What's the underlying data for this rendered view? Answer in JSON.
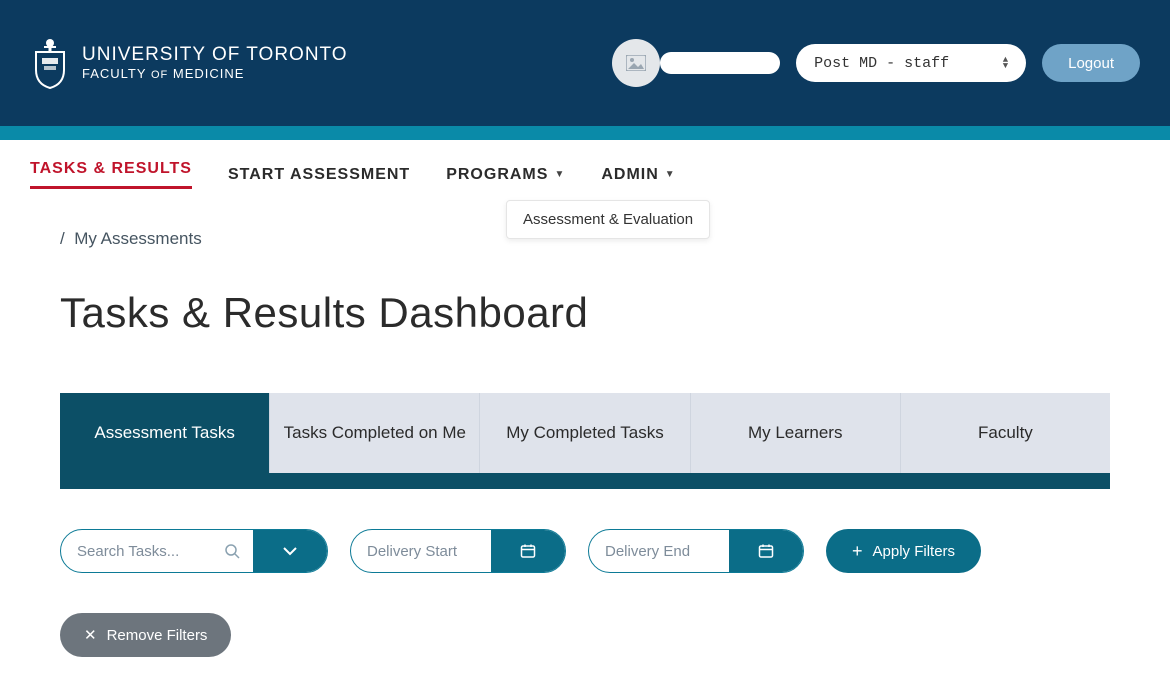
{
  "header": {
    "logo_line1": "UNIVERSITY OF TORONTO",
    "logo_line2_a": "FACULTY",
    "logo_line2_of": "OF",
    "logo_line2_b": "MEDICINE",
    "role_value": "Post MD - staff",
    "logout_label": "Logout"
  },
  "nav": {
    "items": [
      {
        "label": "TASKS & RESULTS",
        "active": true
      },
      {
        "label": "START ASSESSMENT",
        "active": false
      },
      {
        "label": "PROGRAMS",
        "active": false,
        "caret": true
      },
      {
        "label": "ADMIN",
        "active": false,
        "caret": true
      }
    ],
    "dropdown_item": "Assessment & Evaluation"
  },
  "breadcrumb": {
    "sep": "/",
    "current": "My Assessments"
  },
  "page_title": "Tasks & Results Dashboard",
  "tabs": [
    {
      "label": "Assessment Tasks",
      "active": true
    },
    {
      "label": "Tasks Completed on Me",
      "active": false
    },
    {
      "label": "My Completed Tasks",
      "active": false
    },
    {
      "label": "My Learners",
      "active": false
    },
    {
      "label": "Faculty",
      "active": false
    }
  ],
  "filters": {
    "search_placeholder": "Search Tasks...",
    "date_start_placeholder": "Delivery Start",
    "date_end_placeholder": "Delivery End",
    "apply_label": "Apply Filters",
    "remove_label": "Remove Filters"
  }
}
